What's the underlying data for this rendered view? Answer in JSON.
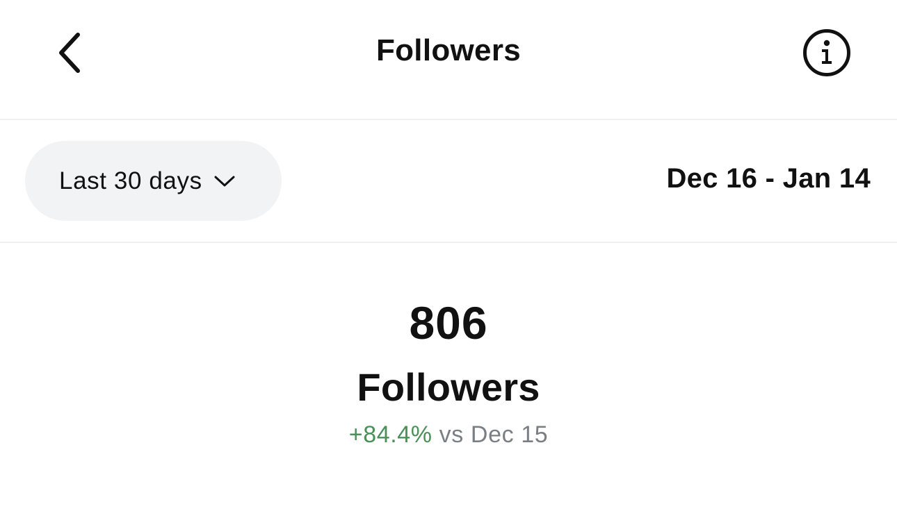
{
  "header": {
    "title": "Followers",
    "back_icon": "chevron-left-icon",
    "info_icon": "info-icon"
  },
  "filter": {
    "range_label": "Last 30 days",
    "dropdown_icon": "chevron-down-icon",
    "date_range": "Dec 16 - Jan 14"
  },
  "summary": {
    "count": "806",
    "label": "Followers",
    "change": "+84.4%",
    "comparison": "vs Dec 15"
  },
  "colors": {
    "positive_change": "#4a9157",
    "muted_text": "#7a7f85",
    "pill_background": "#f1f3f5",
    "divider": "#efefef"
  }
}
